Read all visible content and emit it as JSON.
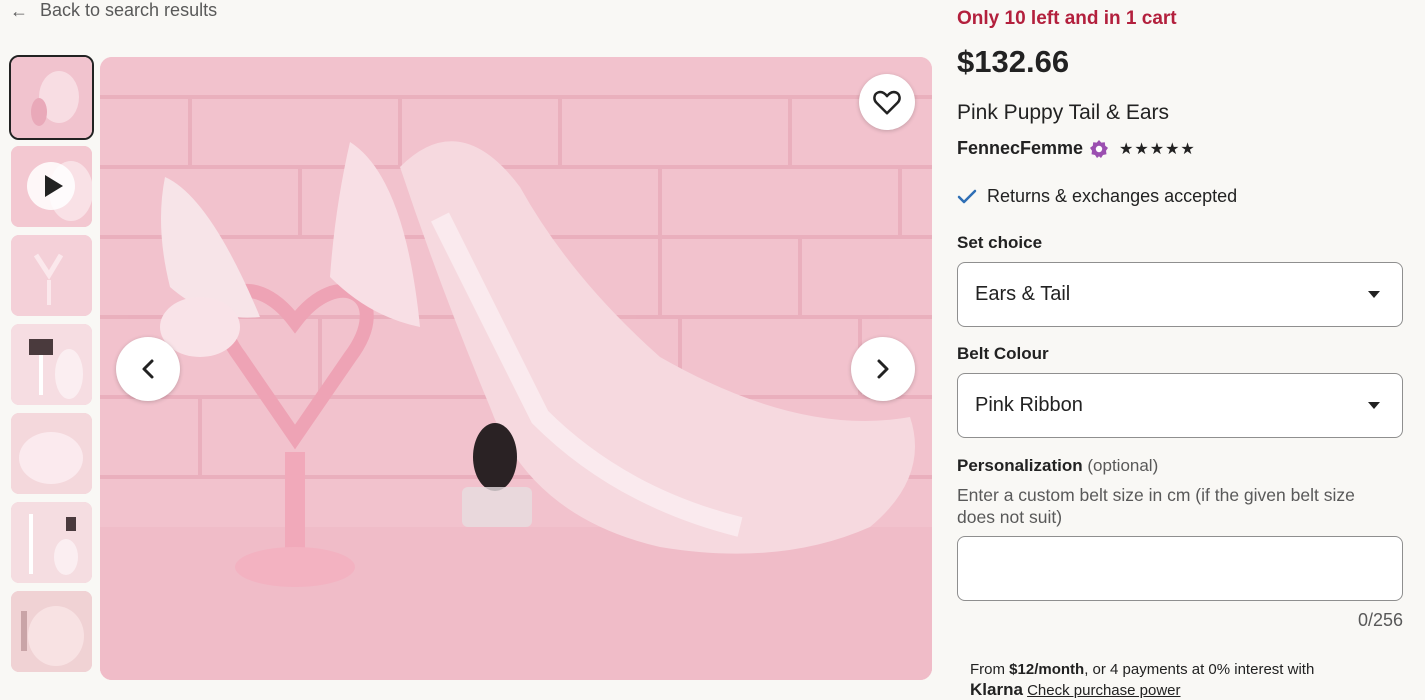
{
  "nav": {
    "back_label": "Back to search results"
  },
  "gallery": {
    "thumbnail_count": 7,
    "video_thumbnail_index": 1
  },
  "listing": {
    "stock_text": "Only 10 left and in 1 cart",
    "price": "$132.66",
    "title": "Pink Puppy Tail & Ears",
    "shop_name": "FennecFemme",
    "rating_stars": "★★★★★",
    "rating": 5,
    "returns_text": "Returns & exchanges accepted"
  },
  "options": {
    "set_choice": {
      "label": "Set choice",
      "value": "Ears & Tail"
    },
    "belt_colour": {
      "label": "Belt Colour",
      "value": "Pink Ribbon"
    }
  },
  "personalization": {
    "label": "Personalization",
    "optional_note": "(optional)",
    "hint": "Enter a custom belt size in cm (if the given belt size does not suit)",
    "value": "",
    "counter": "0/256"
  },
  "financing": {
    "prefix": "From ",
    "monthly": "$12/month",
    "suffix": ", or 4 payments at 0% interest with",
    "brand": "Klarna",
    "link_text": "Check purchase power"
  },
  "colors": {
    "stock_alert": "#b3203d",
    "star_seller_badge": "#9b4fb0",
    "check": "#2f6fb5"
  }
}
